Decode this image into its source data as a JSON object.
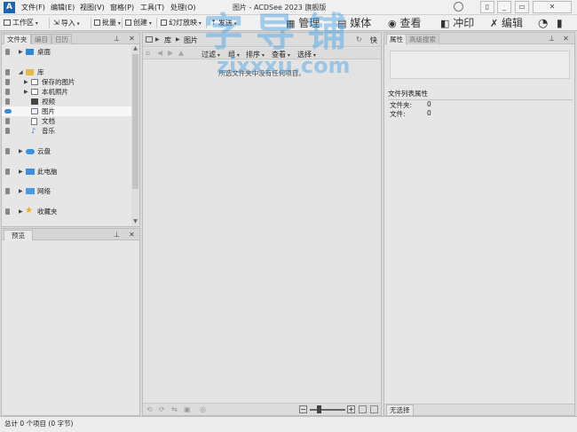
{
  "menu": {
    "items": [
      "文件(F)",
      "编辑(E)",
      "视图(V)",
      "窗格(P)",
      "工具(T)",
      "处理(O)"
    ]
  },
  "window": {
    "title": "图片 - ACDSee 2023 旗舰版"
  },
  "toolbar": {
    "workspace": "工作区",
    "import": "导入",
    "batch": "批量",
    "create": "创建",
    "slideshow": "幻灯放映",
    "send": "发送"
  },
  "modes": {
    "manage": "管理",
    "media": "媒体",
    "view": "查看",
    "develop": "冲印",
    "edit": "编辑"
  },
  "watermark": {
    "big": "字导铺",
    "url": "zixxxu.com"
  },
  "folders_panel": {
    "tabs": [
      "文件夹",
      "编目",
      "日历"
    ],
    "tree": {
      "desktop": "桌面",
      "library": "库",
      "saved_pictures": "保存的图片",
      "camera_roll": "本机照片",
      "videos": "视频",
      "pictures": "图片",
      "documents": "文档",
      "music": "音乐",
      "cloud": "云盘",
      "this_pc": "此电脑",
      "network": "网络",
      "favorites": "收藏夹"
    }
  },
  "preview_panel": {
    "title": "预览"
  },
  "browser": {
    "breadcrumb": [
      "库",
      "图片"
    ],
    "quick": "快",
    "filter_bar": [
      "过滤",
      "组",
      "排序",
      "查看",
      "选择"
    ],
    "empty_message": "所选文件夹中没有任何项目。"
  },
  "properties_panel": {
    "tabs": [
      "属性",
      "高级搜索"
    ],
    "section_title": "文件列表属性",
    "rows": [
      {
        "label": "文件夹:",
        "value": "0"
      },
      {
        "label": "文件:",
        "value": "0"
      }
    ],
    "bottom_tab": "无选择"
  },
  "status": {
    "text": "总计 0 个项目 (0 字节)"
  }
}
